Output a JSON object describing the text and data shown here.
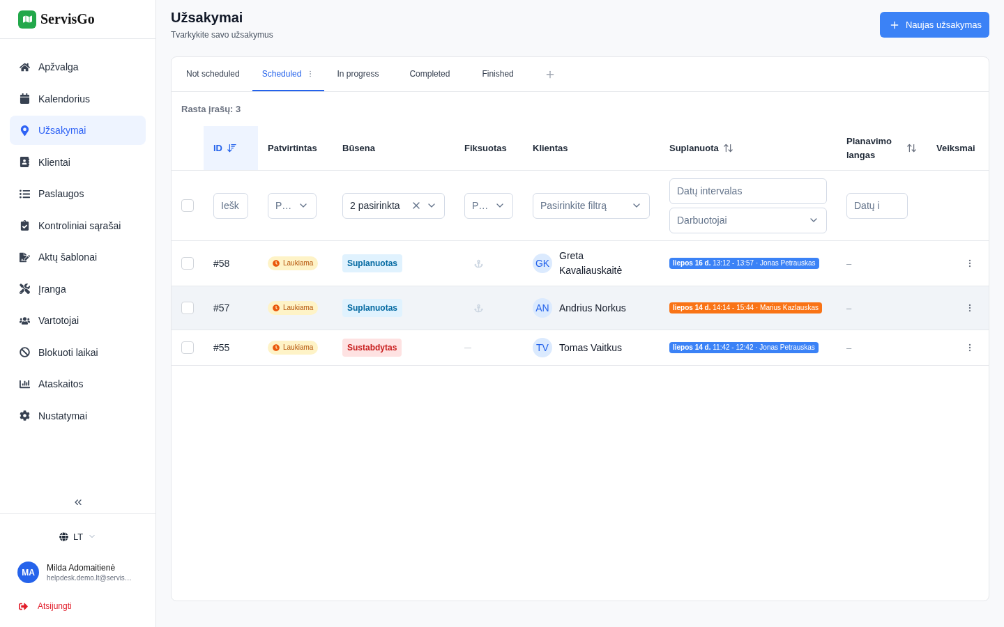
{
  "sidebar": {
    "logo": "ServisGo",
    "items": [
      {
        "label": "Apžvalga",
        "selected": false
      },
      {
        "label": "Kalendorius",
        "selected": false
      },
      {
        "label": "Užsakymai",
        "selected": true
      },
      {
        "label": "Klientai",
        "selected": false
      },
      {
        "label": "Paslaugos",
        "selected": false
      },
      {
        "label": "Kontroliniai sąrašai",
        "selected": false
      },
      {
        "label": "Aktų šablonai",
        "selected": false
      },
      {
        "label": "Įranga",
        "selected": false
      },
      {
        "label": "Vartotojai",
        "selected": false
      },
      {
        "label": "Blokuoti laikai",
        "selected": false
      },
      {
        "label": "Ataskaitos",
        "selected": false
      },
      {
        "label": "Nustatymai",
        "selected": false
      }
    ],
    "language": "LT",
    "user": {
      "initials": "MA",
      "name": "Milda Adomaitienė",
      "email": "helpdesk.demo.lt@servis…"
    },
    "logout": "Atsijungti"
  },
  "header": {
    "title": "Užsakymai",
    "subtitle": "Tvarkykite savo užsakymus",
    "new_button": "Naujas užsakymas"
  },
  "tabs": [
    {
      "label": "Not scheduled",
      "selected": false
    },
    {
      "label": "Scheduled",
      "selected": true
    },
    {
      "label": "In progress",
      "selected": false
    },
    {
      "label": "Completed",
      "selected": false
    },
    {
      "label": "Finished",
      "selected": false
    }
  ],
  "result_count": "Rasta įrašų: 3",
  "table": {
    "columns": [
      {
        "label": "ID",
        "sortable": true,
        "sorted": true
      },
      {
        "label": "Patvirtintas",
        "sortable": false,
        "sorted": false
      },
      {
        "label": "Būsena",
        "sortable": false,
        "sorted": false
      },
      {
        "label": "Fiksuotas",
        "sortable": false,
        "sorted": false
      },
      {
        "label": "Klientas",
        "sortable": false,
        "sorted": false
      },
      {
        "label": "Suplanuota",
        "sortable": true,
        "sorted": false
      },
      {
        "label": "Planavimo langas",
        "sortable": true,
        "sorted": false
      },
      {
        "label": "Veiksmai",
        "sortable": false,
        "sorted": false
      }
    ],
    "select_all": {
      "checked": false
    },
    "filters": [
      {
        "kind": "search",
        "placeholder": "Iešk"
      },
      {
        "kind": "select",
        "placeholder": "P…"
      },
      {
        "kind": "multiselect",
        "value": "2 pasirinkta"
      },
      {
        "kind": "select",
        "placeholder": "P…"
      },
      {
        "kind": "select",
        "placeholder": "Pasirinkite filtrą"
      },
      {
        "kind": "group",
        "fields": [
          {
            "kind": "search",
            "placeholder": "Datų intervalas"
          },
          {
            "kind": "select",
            "placeholder": "Darbuotojai"
          }
        ]
      },
      {
        "kind": "search",
        "placeholder": "Datų i"
      }
    ],
    "rows": [
      {
        "checked": false,
        "highlighted": false,
        "id": "#58",
        "approval": {
          "kind": "pending",
          "label": "Laukiama"
        },
        "status": {
          "kind": "scheduled",
          "label": "Suplanuotas"
        },
        "fixed": true,
        "client": {
          "initials": "GK",
          "name": "Greta Kavaliauskaitė"
        },
        "schedule": {
          "text": "**liepos 16 d.** 13:12 - 13:57 · Jonas Petrauskas",
          "color": "#3b82f6"
        },
        "planning_window": "–"
      },
      {
        "checked": false,
        "highlighted": true,
        "id": "#57",
        "approval": {
          "kind": "pending",
          "label": "Laukiama"
        },
        "status": {
          "kind": "scheduled",
          "label": "Suplanuotas"
        },
        "fixed": true,
        "client": {
          "initials": "AN",
          "name": "Andrius Norkus"
        },
        "schedule": {
          "text": "**liepos 14 d.** 14:14 - 15:44 · Marius Kazlauskas",
          "color": "#f97316"
        },
        "planning_window": "–"
      },
      {
        "checked": false,
        "highlighted": false,
        "id": "#55",
        "approval": {
          "kind": "pending",
          "label": "Laukiama"
        },
        "status": {
          "kind": "stopped",
          "label": "Sustabdytas"
        },
        "fixed": false,
        "client": {
          "initials": "TV",
          "name": "Tomas Vaitkus"
        },
        "schedule": {
          "text": "**liepos 14 d.** 11:42 - 12:42 · Jonas Petrauskas",
          "color": "#3b82f6"
        },
        "planning_window": "–"
      }
    ]
  }
}
